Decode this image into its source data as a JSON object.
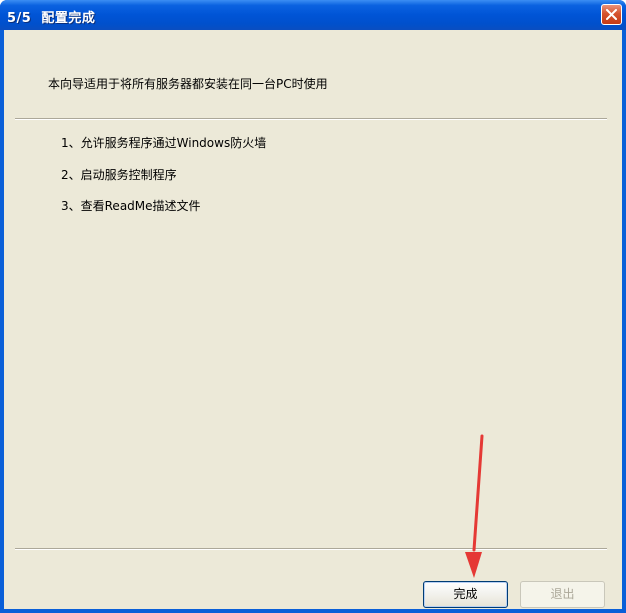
{
  "window": {
    "title": "5/5  配置完成"
  },
  "wizard": {
    "subtitle": "本向导适用于将所有服务器都安装在同一台PC时使用",
    "steps": [
      {
        "label": "1、允许服务程序通过Windows防火墙"
      },
      {
        "label": "2、启动服务控制程序"
      },
      {
        "label": "3、查看ReadMe描述文件"
      }
    ]
  },
  "buttons": {
    "finish_label": "完成",
    "exit_label": "退出"
  },
  "colors": {
    "titlebar": "#0054d6",
    "client_background": "#ece9d8",
    "close_button": "#d5532f",
    "annotation_arrow": "#e53935"
  },
  "icons": {
    "close": "close-icon"
  }
}
